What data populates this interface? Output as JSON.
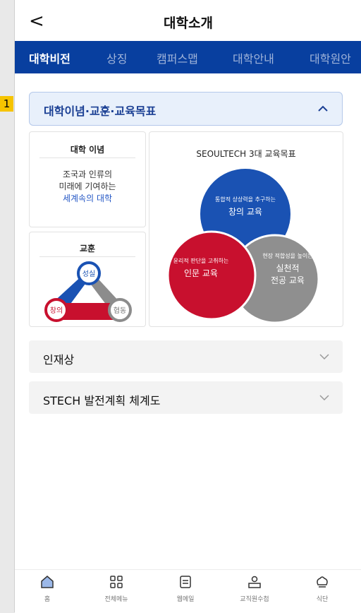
{
  "marker": "1",
  "header": {
    "back_glyph": "<",
    "title": "대학소개"
  },
  "tabs": [
    "대학비전",
    "상징",
    "캠퍼스맵",
    "대학안내",
    "대학원안"
  ],
  "open_section": {
    "label": "대학이념·교훈·교육목표"
  },
  "philosophy_card": {
    "title": "대학 이념",
    "line1": "조국과 인류의",
    "line2": "미래에 기여하는",
    "line3": "세계속의 대학"
  },
  "motto_card": {
    "title": "교훈",
    "top": "성실",
    "left": "창의",
    "right": "협동"
  },
  "goals_card": {
    "title": "SEOULTECH 3대 교육목표",
    "blue_small": "통합적 상상력을 추구하는",
    "blue_big": "창의 교육",
    "red_small": "윤리적 판단을 고취하는",
    "red_big": "인문 교육",
    "gray_small": "현장 적합성을 높이는",
    "gray_big1": "실천적",
    "gray_big2": "전공 교육"
  },
  "sections": [
    "인재상",
    "STECH 발전계획 체계도"
  ],
  "nav": [
    "홈",
    "전체메뉴",
    "웹메일",
    "교직원수첩",
    "식단"
  ],
  "colors": {
    "tab_bar": "#083f9f",
    "accent_blue": "#1a52b3",
    "accent_red": "#c8102e",
    "gray": "#8a8a8a"
  }
}
